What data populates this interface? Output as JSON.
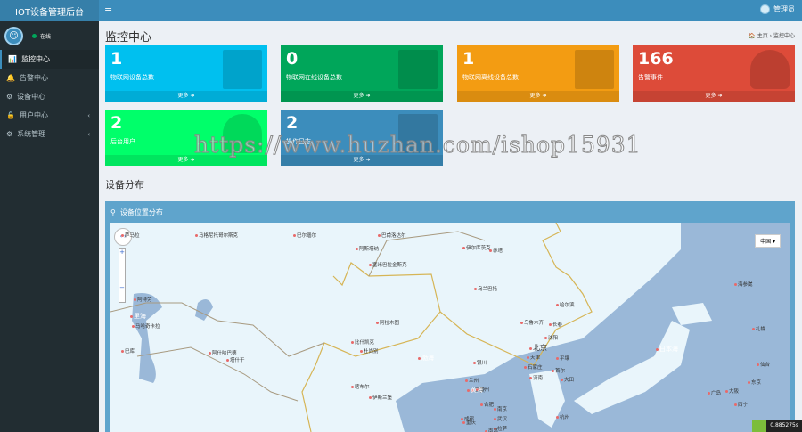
{
  "header": {
    "app_title": "IOT设备管理后台",
    "toggle_icon": "≡",
    "user_name": "管理员"
  },
  "sidebar": {
    "status": "在线",
    "items": [
      {
        "label": "监控中心",
        "icon": "📊"
      },
      {
        "label": "告警中心",
        "icon": "🔔"
      },
      {
        "label": "设备中心",
        "icon": "⚙"
      },
      {
        "label": "用户中心",
        "icon": "🔒",
        "chevron": "‹"
      },
      {
        "label": "系统管理",
        "icon": "⚙",
        "chevron": "‹"
      }
    ]
  },
  "page": {
    "title": "监控中心",
    "breadcrumb": {
      "home": "主页",
      "current": "监控中心"
    }
  },
  "cards": [
    {
      "value": "1",
      "label": "物联网设备总数",
      "more": "更多 ➜",
      "color": "#00c0ef"
    },
    {
      "value": "0",
      "label": "物联网在线设备总数",
      "more": "更多 ➜",
      "color": "#00a65a"
    },
    {
      "value": "1",
      "label": "物联网离线设备总数",
      "more": "更多 ➜",
      "color": "#f39c12"
    },
    {
      "value": "166",
      "label": "告警事件",
      "more": "更多 ➜",
      "color": "#dd4b39"
    },
    {
      "value": "2",
      "label": "后台用户",
      "more": "更多 ➜",
      "color": "#00ff6a"
    },
    {
      "value": "2",
      "label": "操作日志",
      "more": "更多 ➜",
      "color": "#3c8dbc"
    }
  ],
  "section_title": "设备分布",
  "map_panel": {
    "title": "设备位置分布",
    "region_select": "中国 ▾",
    "cities": [
      "萨马拉",
      "马格尼托哥尔斯克",
      "巴尔瑙尔",
      "巴甫洛达尔",
      "阿斯塔纳",
      "塞米巴拉金斯克",
      "伊尔库茨克",
      "赤塔",
      "乌兰巴托",
      "阿特劳",
      "马哈奇卡拉",
      "巴库",
      "阿什哈巴德",
      "塔什干",
      "阿拉木图",
      "比什凯克",
      "杜尚别",
      "喀布尔",
      "伊斯兰堡",
      "乌鲁木齐",
      "西宁",
      "拉萨",
      "哈尔滨",
      "长春",
      "沈阳",
      "北京",
      "天津",
      "石家庄",
      "银川",
      "兰州",
      "西安",
      "郑州",
      "济南",
      "平壤",
      "首尔",
      "大田",
      "海参崴",
      "札幌",
      "仙台",
      "东京",
      "大阪",
      "广岛",
      "成都",
      "重庆",
      "武汉",
      "南京",
      "合肥",
      "杭州",
      "南昌"
    ],
    "seas": [
      "日本海",
      "黄海",
      "渤海",
      "里海"
    ]
  },
  "watermark": "https://www.huzhan.com/ishop15931",
  "debug_badge": "0.885275s"
}
